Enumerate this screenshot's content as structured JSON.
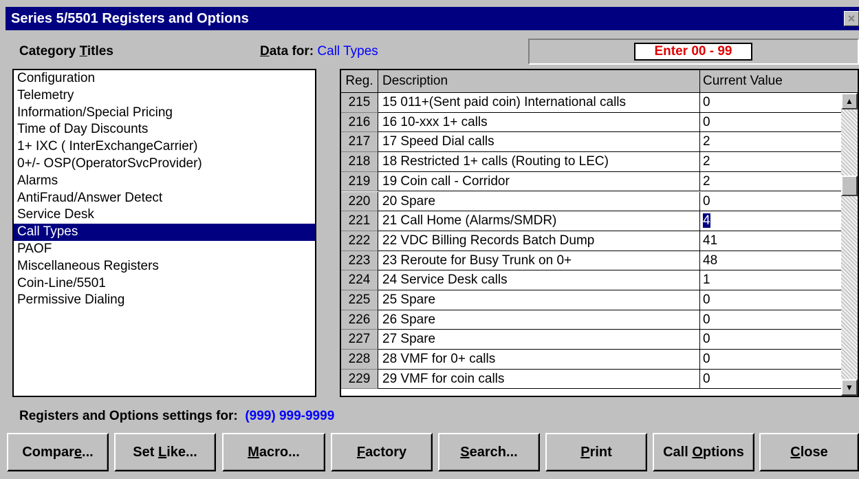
{
  "window": {
    "title": "Series 5/5501 Registers and Options",
    "close_glyph": "×"
  },
  "labels": {
    "category_pre": "Category ",
    "category_u": "T",
    "category_post": "itles",
    "data_u": "D",
    "data_post": "ata for:",
    "data_value": "Call Types",
    "enter_range": "Enter 00 - 99",
    "settings_for": "Registers and Options settings for:",
    "phone": "(999) 999-9999"
  },
  "categories": [
    {
      "label": "Configuration"
    },
    {
      "label": "Telemetry"
    },
    {
      "label": "Information/Special Pricing"
    },
    {
      "label": "Time of Day Discounts"
    },
    {
      "label": "1+ IXC ( InterExchangeCarrier)"
    },
    {
      "label": "0+/- OSP(OperatorSvcProvider)"
    },
    {
      "label": "Alarms"
    },
    {
      "label": "AntiFraud/Answer Detect"
    },
    {
      "label": "Service Desk"
    },
    {
      "label": "Call Types",
      "selected": true
    },
    {
      "label": "PAOF"
    },
    {
      "label": "Miscellaneous Registers"
    },
    {
      "label": "Coin-Line/5501"
    },
    {
      "label": "Permissive Dialing"
    }
  ],
  "table": {
    "headers": {
      "reg": "Reg.",
      "desc": "Description",
      "value": "Current Value"
    },
    "rows": [
      {
        "reg": "215",
        "desc": "15 011+(Sent paid coin)  International calls",
        "value": "0"
      },
      {
        "reg": "216",
        "desc": "16 10-xxx 1+ calls",
        "value": "0"
      },
      {
        "reg": "217",
        "desc": "17 Speed Dial calls",
        "value": "2"
      },
      {
        "reg": "218",
        "desc": "18 Restricted 1+ calls (Routing to LEC)",
        "value": "2"
      },
      {
        "reg": "219",
        "desc": "19 Coin call - Corridor",
        "value": "2"
      },
      {
        "reg": "220",
        "desc": "20 Spare",
        "value": "0"
      },
      {
        "reg": "221",
        "desc": "21 Call Home (Alarms/SMDR)",
        "value": "4",
        "highlight": true
      },
      {
        "reg": "222",
        "desc": "22 VDC Billing Records Batch Dump",
        "value": "41"
      },
      {
        "reg": "223",
        "desc": "23 Reroute for Busy Trunk on 0+",
        "value": "48"
      },
      {
        "reg": "224",
        "desc": "24 Service Desk calls",
        "value": "1"
      },
      {
        "reg": "225",
        "desc": "25 Spare",
        "value": "0"
      },
      {
        "reg": "226",
        "desc": "26 Spare",
        "value": "0"
      },
      {
        "reg": "227",
        "desc": "27 Spare",
        "value": "0"
      },
      {
        "reg": "228",
        "desc": "28 VMF for 0+ calls",
        "value": "0"
      },
      {
        "reg": "229",
        "desc": "29 VMF for coin calls",
        "value": "0"
      }
    ]
  },
  "buttons": [
    {
      "pre": "Compar",
      "u": "e",
      "post": "...",
      "name": "compare-button"
    },
    {
      "pre": "Set ",
      "u": "L",
      "post": "ike...",
      "name": "set-like-button"
    },
    {
      "pre": "",
      "u": "M",
      "post": "acro...",
      "name": "macro-button"
    },
    {
      "pre": "",
      "u": "F",
      "post": "actory",
      "name": "factory-button"
    },
    {
      "pre": "",
      "u": "S",
      "post": "earch...",
      "name": "search-button"
    },
    {
      "pre": "",
      "u": "P",
      "post": "rint",
      "name": "print-button"
    },
    {
      "pre": "Call ",
      "u": "O",
      "post": "ptions",
      "name": "call-options-button"
    },
    {
      "pre": "",
      "u": "C",
      "post": "lose",
      "name": "close-button"
    }
  ],
  "colors": {
    "titlebar": "#000080",
    "selection": "#000080",
    "enter_text": "#e00000",
    "link_blue": "#0000ff"
  }
}
